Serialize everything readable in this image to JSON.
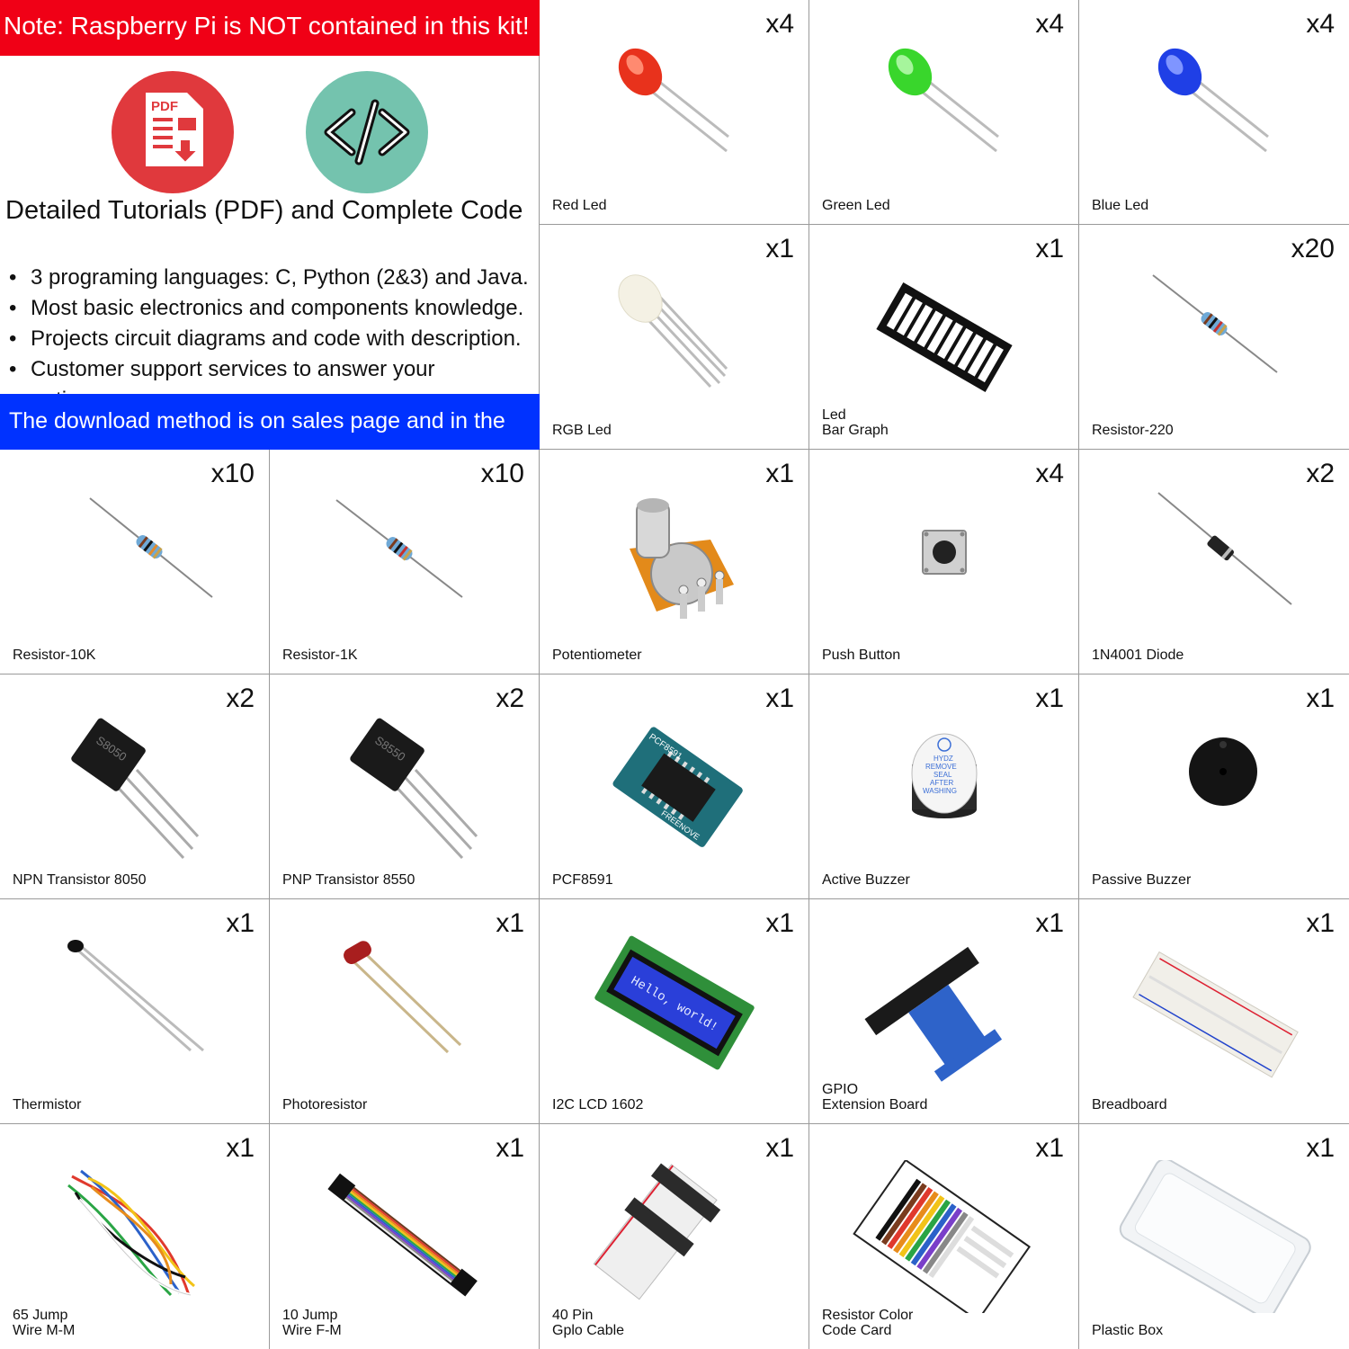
{
  "info": {
    "note": "Note: Raspberry Pi is NOT contained in this kit!",
    "pdf_icon": "pdf-document-icon",
    "pdf_icon_text": "PDF",
    "code_icon": "code-brackets-icon",
    "headline": "Detailed Tutorials (PDF) and Complete Code",
    "bullets": [
      "3 programing languages: C, Python (2&3) and Java.",
      "Most basic electronics and components knowledge.",
      "Projects circuit diagrams and code with description.",
      "Customer support services to answer your questions."
    ],
    "download": "The download method is on sales page and in the box.",
    "colors": {
      "note_bg": "#f00016",
      "download_bg": "#0032ff",
      "pdf_red": "#e0393d",
      "code_teal": "#74c3ae"
    }
  },
  "items": [
    {
      "qty": "x4",
      "label": "Red Led",
      "icon": "red-led-icon"
    },
    {
      "qty": "x4",
      "label": "Green Led",
      "icon": "green-led-icon"
    },
    {
      "qty": "x4",
      "label": "Blue Led",
      "icon": "blue-led-icon"
    },
    {
      "qty": "x1",
      "label": "RGB Led",
      "icon": "rgb-led-icon"
    },
    {
      "qty": "x1",
      "label": "Led\nBar Graph",
      "icon": "led-bar-graph-icon"
    },
    {
      "qty": "x20",
      "label": "Resistor-220",
      "icon": "resistor-icon"
    },
    {
      "qty": "x10",
      "label": "Resistor-10K",
      "icon": "resistor-icon"
    },
    {
      "qty": "x10",
      "label": "Resistor-1K",
      "icon": "resistor-icon"
    },
    {
      "qty": "x1",
      "label": "Potentiometer",
      "icon": "potentiometer-icon"
    },
    {
      "qty": "x4",
      "label": "Push Button",
      "icon": "push-button-icon"
    },
    {
      "qty": "x2",
      "label": "1N4001 Diode",
      "icon": "diode-icon"
    },
    {
      "qty": "x2",
      "label": "NPN Transistor 8050",
      "icon": "transistor-icon",
      "chip_text": "S8050"
    },
    {
      "qty": "x2",
      "label": "PNP Transistor  8550",
      "icon": "transistor-icon",
      "chip_text": "S8550"
    },
    {
      "qty": "x1",
      "label": "PCF8591",
      "icon": "pcf8591-module-icon",
      "chip_text": "PCF8591",
      "brand": "FREENOVE"
    },
    {
      "qty": "x1",
      "label": "Active Buzzer",
      "icon": "active-buzzer-icon",
      "sticker": [
        "HYDZ",
        "REMOVE",
        "SEAL",
        "AFTER",
        "WASHING"
      ]
    },
    {
      "qty": "x1",
      "label": "Passive Buzzer",
      "icon": "passive-buzzer-icon"
    },
    {
      "qty": "x1",
      "label": "Thermistor",
      "icon": "thermistor-icon"
    },
    {
      "qty": "x1",
      "label": "Photoresistor",
      "icon": "photoresistor-icon"
    },
    {
      "qty": "x1",
      "label": "I2C LCD 1602",
      "icon": "lcd-1602-icon",
      "screen_text": "Hello, world!"
    },
    {
      "qty": "x1",
      "label": "GPIO\nExtension Board",
      "icon": "gpio-extension-board-icon"
    },
    {
      "qty": "x1",
      "label": "Breadboard",
      "icon": "breadboard-icon"
    },
    {
      "qty": "x1",
      "label": "65 Jump\nWire M-M",
      "icon": "jumper-wires-icon"
    },
    {
      "qty": "x1",
      "label": "10 Jump\nWire F-M",
      "icon": "ribbon-jumper-icon"
    },
    {
      "qty": "x1",
      "label": "40 Pin\nGplo Cable",
      "icon": "ribbon-cable-icon"
    },
    {
      "qty": "x1",
      "label": "Resistor Color\nCode Card",
      "icon": "resistor-card-icon"
    },
    {
      "qty": "x1",
      "label": "Plastic Box",
      "icon": "plastic-box-icon"
    }
  ]
}
